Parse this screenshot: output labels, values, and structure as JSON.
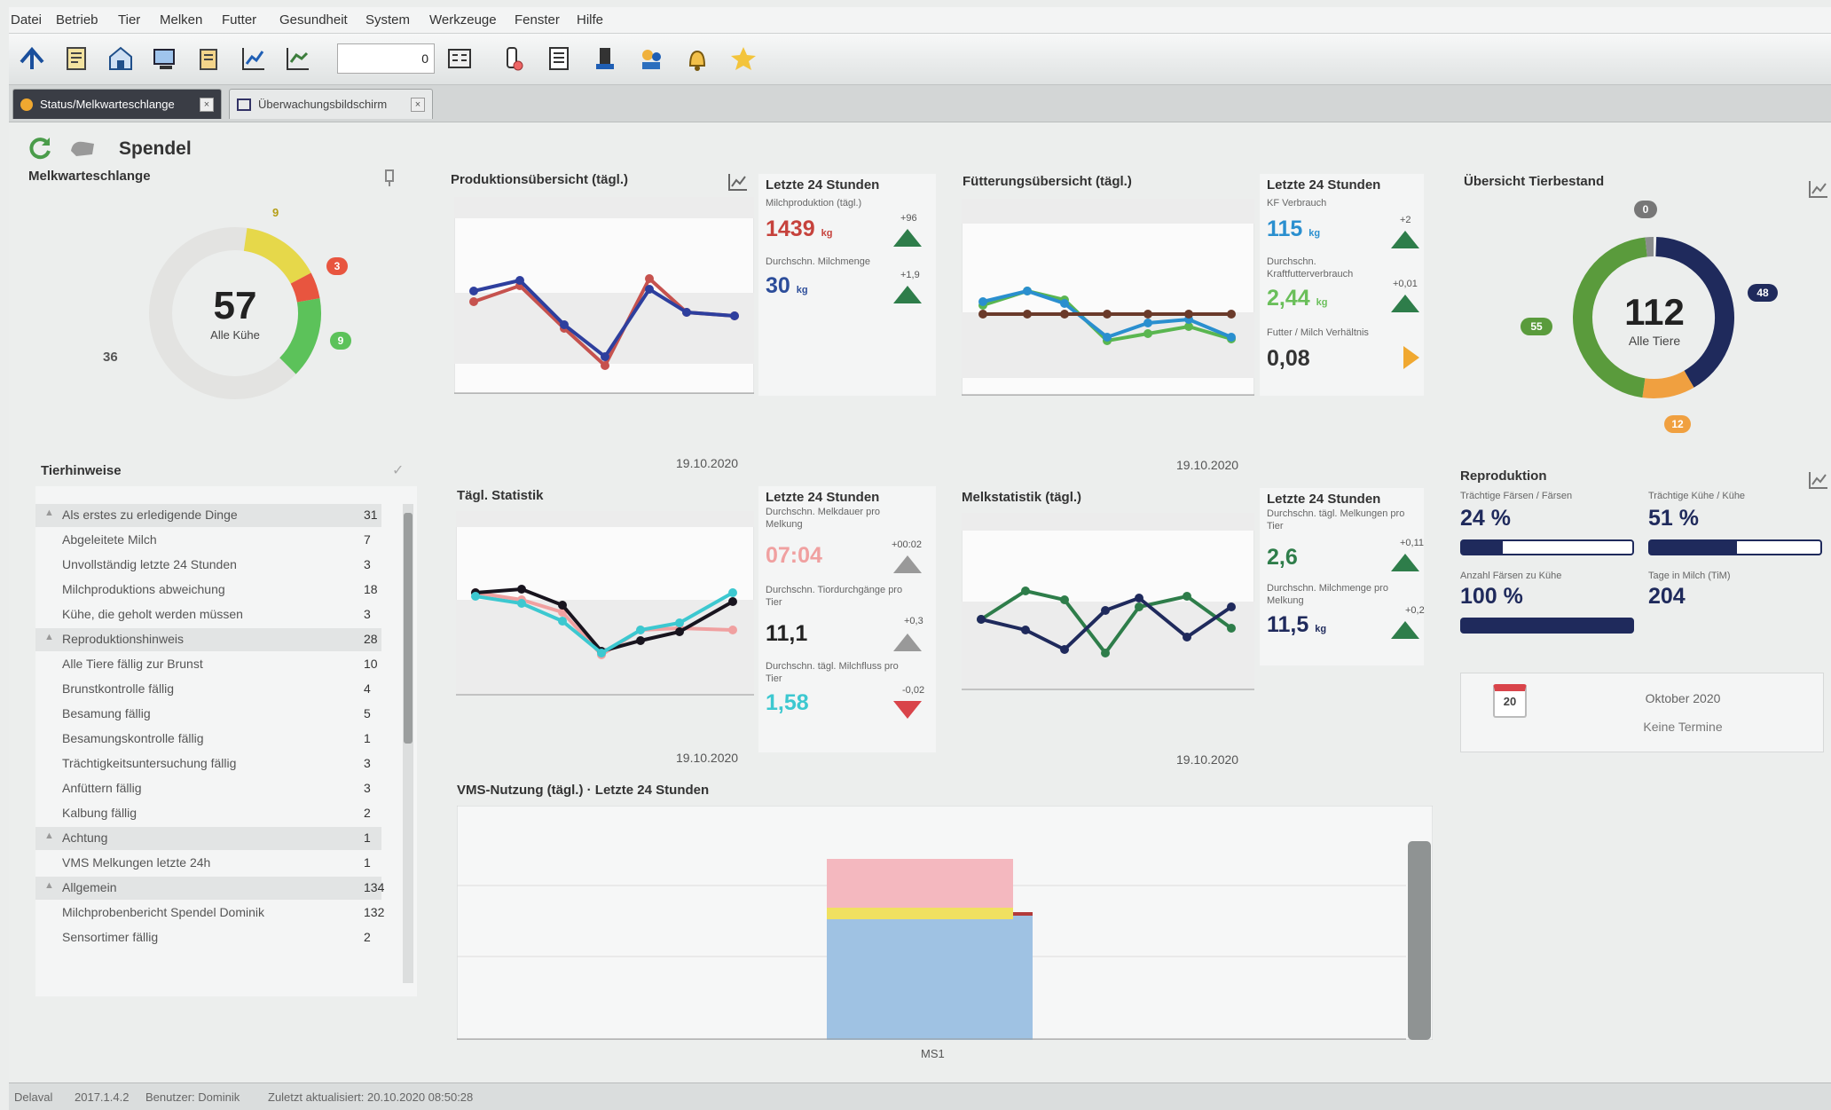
{
  "menu": [
    "Datei",
    "Betrieb",
    "Tier",
    "Melken",
    "Futter",
    "Gesundheit",
    "System",
    "Werkzeuge",
    "Fenster",
    "Hilfe"
  ],
  "toolbar": {
    "number_value": "0"
  },
  "tabs": [
    {
      "label": "Status/Melkwarteschlange"
    },
    {
      "label": "Überwachungsbildschirm"
    }
  ],
  "header": {
    "title": "Spendel"
  },
  "queue": {
    "title": "Melkwarteschlange",
    "total": "57",
    "total_label": "Alle Kühe",
    "left_count": "36",
    "yellow": "9",
    "red": "3",
    "green": "9",
    "colors": {
      "yellow": "#e6d84a",
      "red": "#e8553f",
      "green": "#5cc25a",
      "grey": "#e3e3e1"
    }
  },
  "tierhinweise": {
    "title": "Tierhinweise",
    "rows": [
      {
        "label": "Als erstes zu erledigende Dinge",
        "count": "31",
        "group": true
      },
      {
        "label": "Abgeleitete Milch",
        "count": "7",
        "group": false
      },
      {
        "label": "Unvollständig letzte 24 Stunden",
        "count": "3",
        "group": false
      },
      {
        "label": "Milchproduktions abweichung",
        "count": "18",
        "group": false
      },
      {
        "label": "Kühe, die geholt werden müssen",
        "count": "3",
        "group": false
      },
      {
        "label": "Reproduktionshinweis",
        "count": "28",
        "group": true
      },
      {
        "label": "Alle Tiere fällig zur Brunst",
        "count": "10",
        "group": false
      },
      {
        "label": "Brunstkontrolle fällig",
        "count": "4",
        "group": false
      },
      {
        "label": "Besamung fällig",
        "count": "5",
        "group": false
      },
      {
        "label": "Besamungskontrolle fällig",
        "count": "1",
        "group": false
      },
      {
        "label": "Trächtigkeitsuntersuchung fällig",
        "count": "3",
        "group": false
      },
      {
        "label": "Anfüttern fällig",
        "count": "3",
        "group": false
      },
      {
        "label": "Kalbung fällig",
        "count": "2",
        "group": false
      },
      {
        "label": "Achtung",
        "count": "1",
        "group": true
      },
      {
        "label": "VMS Melkungen letzte 24h",
        "count": "1",
        "group": false
      },
      {
        "label": "Allgemein",
        "count": "134",
        "group": true
      },
      {
        "label": "Milchprobenbericht Spendel Dominik",
        "count": "132",
        "group": false
      },
      {
        "label": "Sensortimer fällig",
        "count": "2",
        "group": false
      }
    ]
  },
  "produktion": {
    "title": "Produktionsübersicht (tägl.)",
    "date": "19.10.2020",
    "kpi_title": "Letzte 24 Stunden",
    "k1_label": "Milchproduktion (tägl.)",
    "k1_value": "1439",
    "k1_unit": "kg",
    "k1_delta": "+96",
    "k2_label": "Durchschn. Milchmenge",
    "k2_value": "30",
    "k2_unit": "kg",
    "k2_delta": "+1,9"
  },
  "futterung": {
    "title": "Fütterungsübersicht (tägl.)",
    "date": "19.10.2020",
    "kpi_title": "Letzte 24 Stunden",
    "k1_label": "KF Verbrauch",
    "k1_value": "115",
    "k1_unit": "kg",
    "k1_delta": "+2",
    "k2_label": "Durchschn. Kraftfutterverbrauch",
    "k2_value": "2,44",
    "k2_unit": "kg",
    "k2_delta": "+0,01",
    "k3_label": "Futter / Milch Verhältnis",
    "k3_value": "0,08"
  },
  "tierbestand": {
    "title": "Übersicht Tierbestand",
    "total": "112",
    "total_label": "Alle Tiere",
    "top_badge": "0",
    "right_badge": "48",
    "left_badge": "55",
    "bottom_badge": "12"
  },
  "statistik": {
    "title": "Tägl. Statistik",
    "date": "19.10.2020",
    "kpi_title": "Letzte 24 Stunden",
    "k1_label": "Durchschn. Melkdauer pro Melkung",
    "k1_value": "07:04",
    "k1_delta": "+00:02",
    "k2_label": "Durchschn. Tiordurchgänge pro Tier",
    "k2_value": "11,1",
    "k2_delta": "+0,3",
    "k3_label": "Durchschn. tägl. Milchfluss pro Tier",
    "k3_value": "1,58",
    "k3_delta": "-0,02"
  },
  "melkstatistik": {
    "title": "Melkstatistik (tägl.)",
    "date": "19.10.2020",
    "kpi_title": "Letzte 24 Stunden",
    "k1_label": "Durchschn. tägl. Melkungen pro Tier",
    "k1_value": "2,6",
    "k1_delta": "+0,11",
    "k2_label": "Durchschn. Milchmenge pro Melkung",
    "k2_value": "11,5",
    "k2_unit": "kg",
    "k2_delta": "+0,2"
  },
  "reproduktion": {
    "title": "Reproduktion",
    "r1_label": "Trächtige Färsen / Färsen",
    "r1_value": "24 %",
    "r1_fraction": 0.24,
    "r2_label": "Trächtige Kühe / Kühe",
    "r2_value": "51 %",
    "r2_fraction": 0.51,
    "r3_label": "Anzahl Färsen zu Kühe",
    "r3_value": "100 %",
    "r3_fraction": 1.0,
    "r4_label": "Tage in Milch (TiM)",
    "r4_value": "204"
  },
  "calendar": {
    "day": "20",
    "month": "Oktober 2020",
    "note": "Keine Termine"
  },
  "vms": {
    "title": "VMS-Nutzung (tägl.) · Letzte 24 Stunden",
    "x_label": "MS1"
  },
  "status": {
    "app": "Delaval",
    "version": "2017.1.4.2",
    "user": "Benutzer: Dominik",
    "updated": "Zuletzt aktualisiert: 20.10.2020 08:50:28"
  }
}
